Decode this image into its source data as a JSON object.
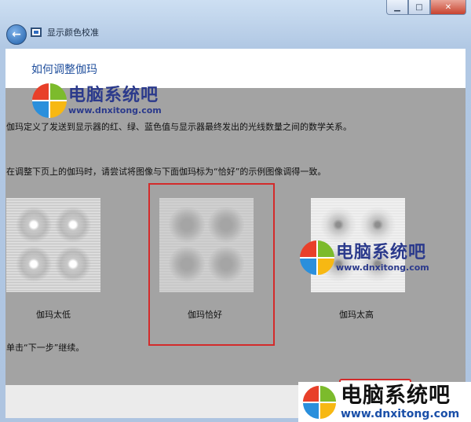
{
  "window": {
    "title": "显示颜色校准"
  },
  "heading": "如何调整伽玛",
  "body": {
    "line1": "伽玛定义了发送到显示器的红、绿、蓝色值与显示器最终发出的光线数量之间的数学关系。",
    "line2": "在调整下页上的伽玛时，请尝试将图像与下面伽玛标为“恰好”的示例图像调得一致。",
    "line3": "单击“下一步”继续。"
  },
  "samples": [
    {
      "label": "伽玛太低"
    },
    {
      "label": "伽玛恰好",
      "highlighted": true
    },
    {
      "label": "伽玛太高"
    }
  ],
  "watermark": {
    "name": "电脑系统吧",
    "url": "www.dnxitong.com"
  },
  "colors": {
    "highlight": "#d32b2b",
    "heading": "#1f4e9c",
    "brand": "#2b3a8c"
  },
  "icons": [
    "back-arrow-icon",
    "display-calibration-icon",
    "minimize-icon",
    "maximize-icon",
    "close-icon",
    "windows-logo-icon"
  ]
}
